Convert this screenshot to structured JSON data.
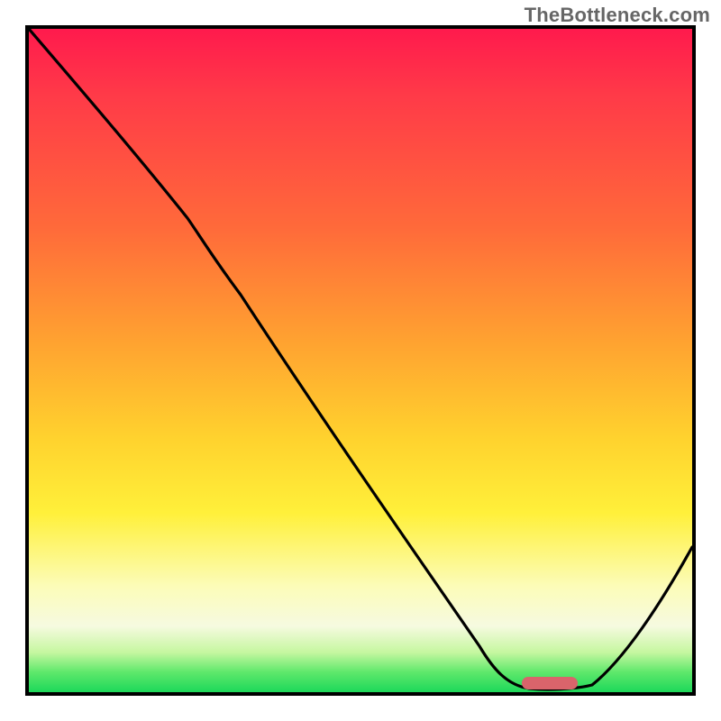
{
  "watermark": "TheBottleneck.com",
  "chart_data": {
    "type": "line",
    "title": "",
    "xlabel": "",
    "ylabel": "",
    "xlim": [
      0,
      100
    ],
    "ylim": [
      0,
      100
    ],
    "x": [
      0,
      8,
      16,
      24,
      32,
      40,
      48,
      56,
      64,
      70,
      76,
      80,
      84,
      90,
      96,
      100
    ],
    "values": [
      100,
      90,
      80,
      71,
      60,
      47,
      34,
      22,
      10,
      5,
      1,
      0,
      1,
      6,
      16,
      22
    ],
    "annotations": [
      {
        "kind": "target_marker",
        "x_range": [
          75,
          83
        ],
        "y": 1,
        "color": "#d9646b"
      }
    ],
    "background_gradient": {
      "orientation": "vertical",
      "stops": [
        {
          "pos": 0.0,
          "color": "#ff1a4d"
        },
        {
          "pos": 0.3,
          "color": "#ff6a3a"
        },
        {
          "pos": 0.62,
          "color": "#ffd32e"
        },
        {
          "pos": 0.84,
          "color": "#fcfcb8"
        },
        {
          "pos": 0.97,
          "color": "#5ee86b"
        },
        {
          "pos": 1.0,
          "color": "#1dd85a"
        }
      ]
    }
  }
}
